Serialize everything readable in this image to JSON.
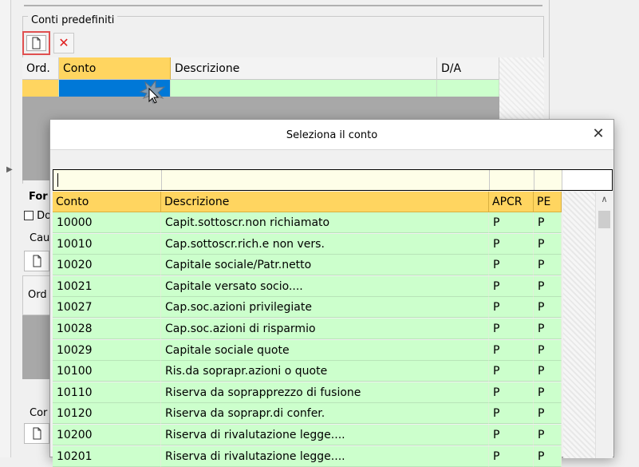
{
  "panel": {
    "group_title": "Conti predefiniti",
    "new_icon": "new-document-icon",
    "delete_icon": "delete-x-icon",
    "delete_glyph": "✕",
    "columns": [
      "Ord.",
      "Conto",
      "Descrizione",
      "D/A"
    ],
    "obscured_labels": [
      "For",
      "Do",
      "Cau",
      "Ord",
      "Cor"
    ]
  },
  "dialog": {
    "title": "Seleziona il conto",
    "close_glyph": "✕",
    "filter_value": "",
    "columns": [
      "Conto",
      "Descrizione",
      "APCR",
      "PE"
    ],
    "rows": [
      {
        "conto": "10000",
        "descrizione": "Capit.sottoscr.non richiamato",
        "apcr": "P",
        "pe": "P"
      },
      {
        "conto": "10010",
        "descrizione": "Cap.sottoscr.rich.e non vers.",
        "apcr": "P",
        "pe": "P"
      },
      {
        "conto": "10020",
        "descrizione": "Capitale sociale/Patr.netto",
        "apcr": "P",
        "pe": "P"
      },
      {
        "conto": "10021",
        "descrizione": "Capitale versato socio....",
        "apcr": "P",
        "pe": "P"
      },
      {
        "conto": "10027",
        "descrizione": "Cap.soc.azioni privilegiate",
        "apcr": "P",
        "pe": "P"
      },
      {
        "conto": "10028",
        "descrizione": "Cap.soc.azioni di risparmio",
        "apcr": "P",
        "pe": "P"
      },
      {
        "conto": "10029",
        "descrizione": "Capitale sociale quote",
        "apcr": "P",
        "pe": "P"
      },
      {
        "conto": "10100",
        "descrizione": "Ris.da soprapr.azioni o quote",
        "apcr": "P",
        "pe": "P"
      },
      {
        "conto": "10110",
        "descrizione": "Riserva da soprapprezzo di fusione",
        "apcr": "P",
        "pe": "P"
      },
      {
        "conto": "10120",
        "descrizione": "Riserva da soprapr.di confer.",
        "apcr": "P",
        "pe": "P"
      },
      {
        "conto": "10200",
        "descrizione": "Riserva di rivalutazione legge....",
        "apcr": "P",
        "pe": "P"
      },
      {
        "conto": "10201",
        "descrizione": "Riserva di rivalutazione legge....",
        "apcr": "P",
        "pe": "P"
      }
    ]
  },
  "colors": {
    "header_yellow": "#ffd560",
    "row_green": "#ccffcc",
    "selection_blue": "#0078d7",
    "highlight_red": "#e05050"
  }
}
